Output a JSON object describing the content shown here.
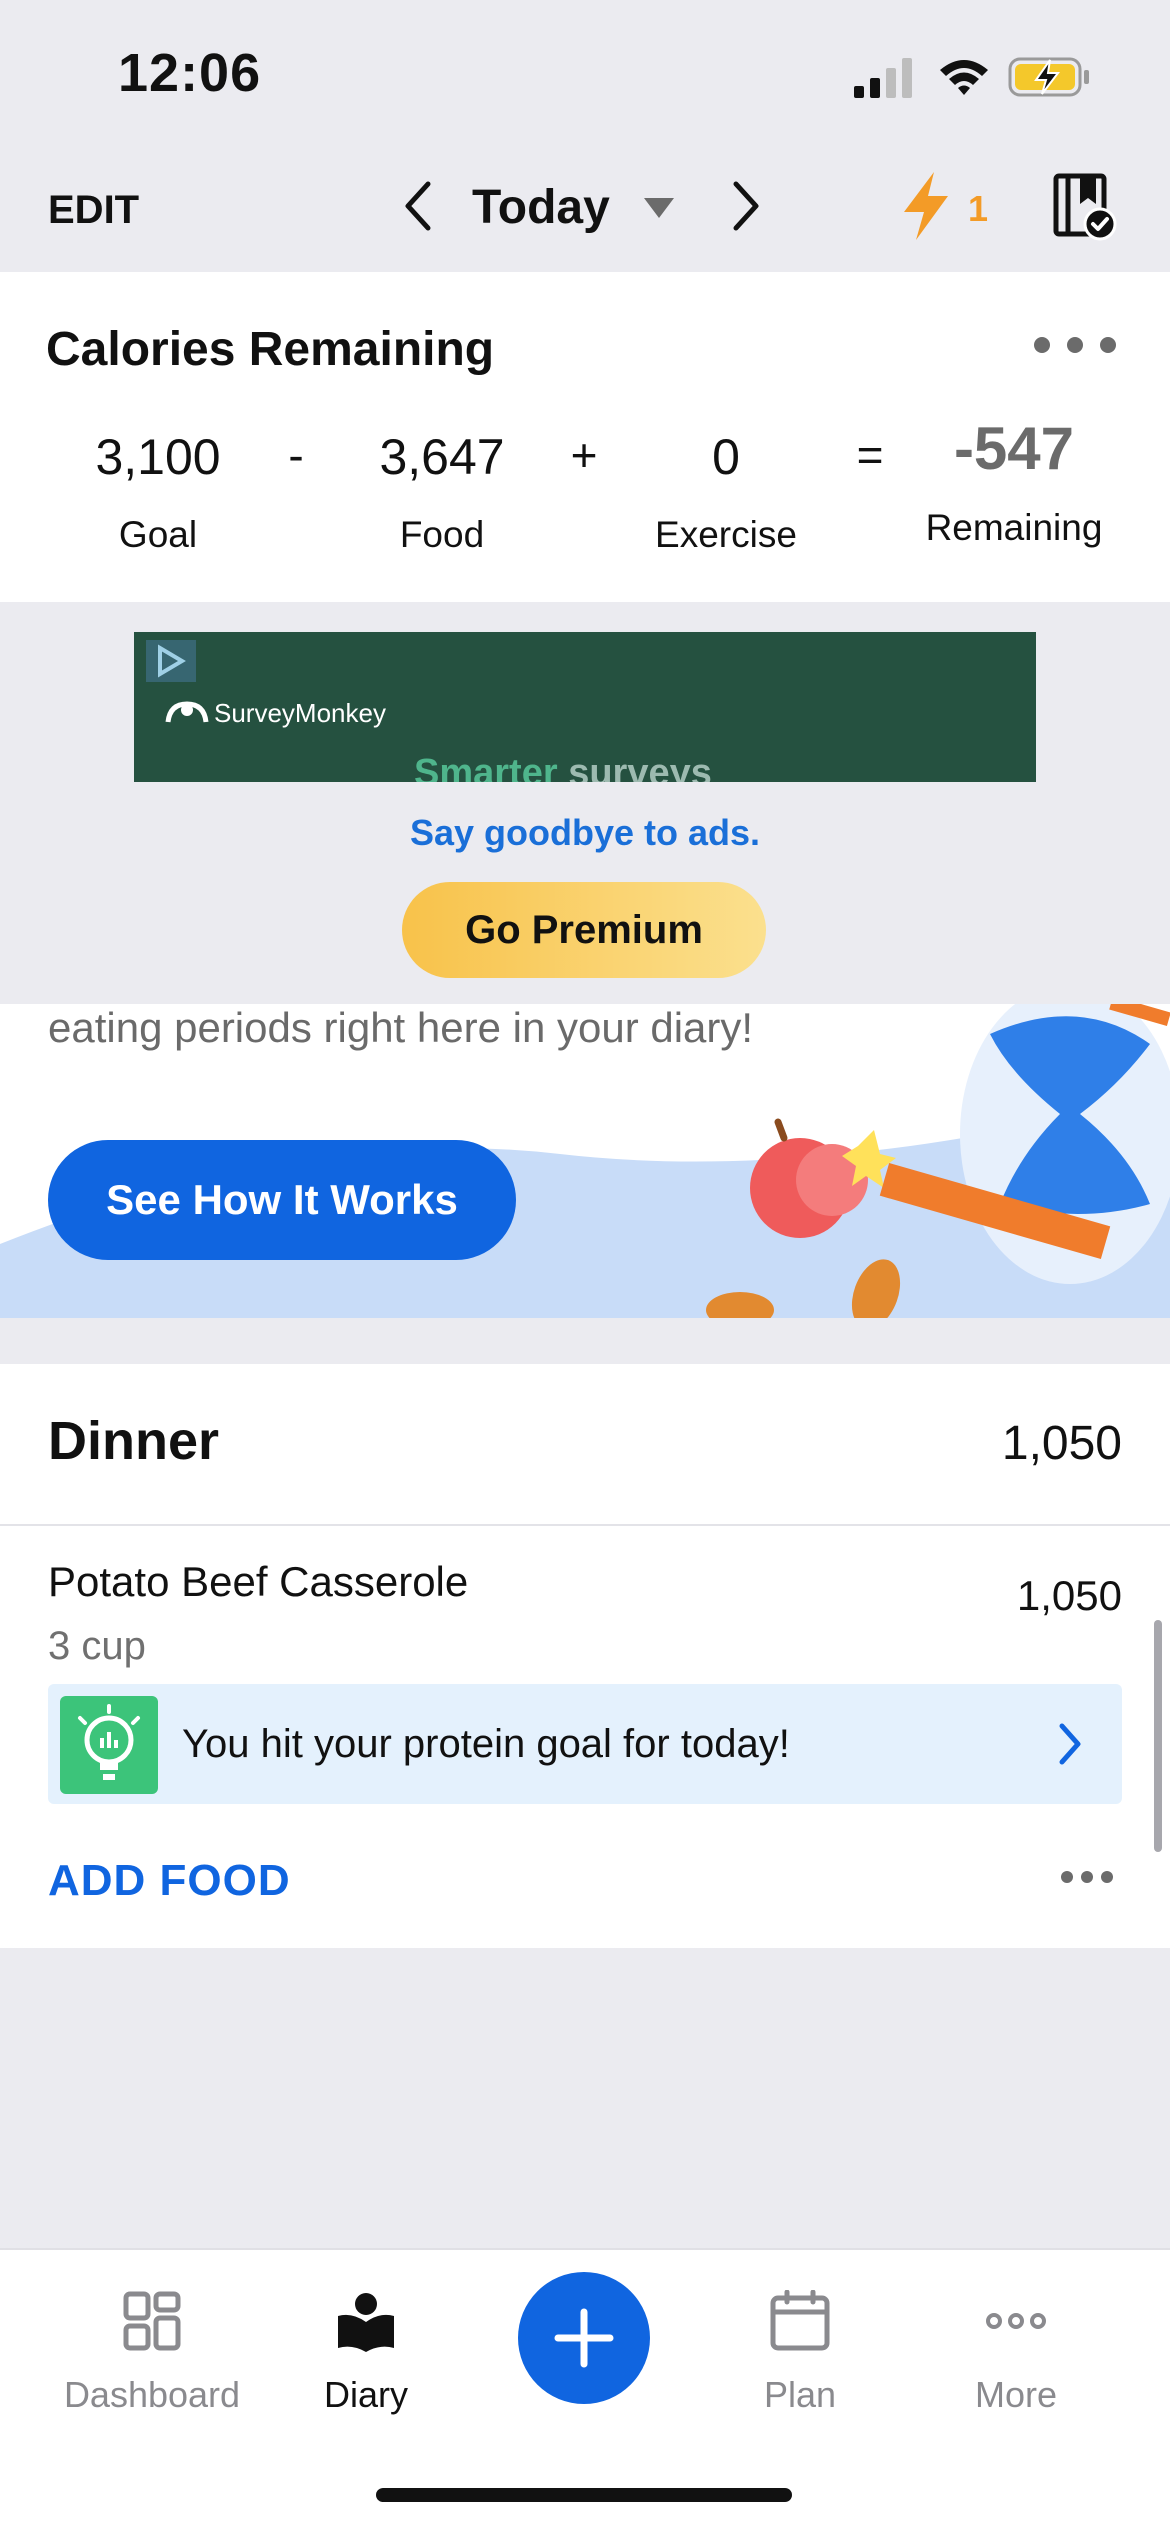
{
  "status_bar": {
    "time": "12:06"
  },
  "nav": {
    "edit": "EDIT",
    "title": "Today",
    "streak_count": "1"
  },
  "calories": {
    "title": "Calories Remaining",
    "goal": {
      "value": "3,100",
      "label": "Goal"
    },
    "food": {
      "value": "3,647",
      "label": "Food"
    },
    "exercise": {
      "value": "0",
      "label": "Exercise"
    },
    "remaining": {
      "value": "-547",
      "label": "Remaining"
    },
    "op_minus": "-",
    "op_plus": "+",
    "op_equals": "="
  },
  "ad": {
    "brand": "SurveyMonkey",
    "tagline_a": "Smarter",
    "tagline_b": "surveys",
    "cta": "Say goodbye to ads.",
    "premium_button": "Go Premium"
  },
  "promo": {
    "text": "eating periods right here in your diary!",
    "button": "See How It Works"
  },
  "dinner": {
    "title": "Dinner",
    "total": "1,050",
    "items": [
      {
        "name": "Potato Beef Casserole",
        "serving": "3 cup",
        "calories": "1,050"
      }
    ],
    "insight": "You hit your protein goal for today!",
    "add_food": "ADD FOOD"
  },
  "tabs": [
    {
      "label": "Dashboard",
      "icon": "dashboard-grid-icon"
    },
    {
      "label": "Diary",
      "icon": "diary-book-icon"
    },
    {
      "label": "Plan",
      "icon": "calendar-icon"
    },
    {
      "label": "More",
      "icon": "more-dots-icon"
    }
  ],
  "colors": {
    "accent_blue": "#1065e0",
    "streak_orange": "#f39b27",
    "premium_yellow": "#f8c24a",
    "insight_green": "#3cc47a",
    "ad_green": "#255140"
  }
}
